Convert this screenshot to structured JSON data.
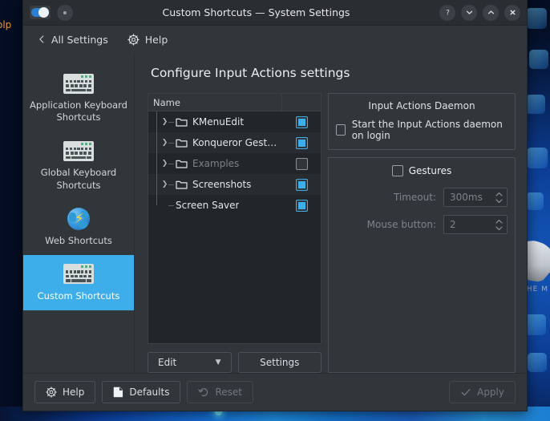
{
  "desktop": {
    "background_window_title": "olp",
    "kde_watermark": "HE  M",
    "accent_color": "#3daee9"
  },
  "window": {
    "title": "Custom Shortcuts — System Settings",
    "titlebar_left": {
      "toggle_name": "window-toggle-switch",
      "menu_button_name": "window-menu-button"
    },
    "controls": [
      {
        "name": "help-button",
        "glyph": "?"
      },
      {
        "name": "minimize-button",
        "glyph": "chevron-down"
      },
      {
        "name": "maximize-button",
        "glyph": "chevron-up"
      },
      {
        "name": "close-button",
        "glyph": "x"
      }
    ]
  },
  "toolbar": {
    "back_label": "All Settings",
    "help_label": "Help"
  },
  "sidebar": {
    "items": [
      {
        "label": "Application Keyboard Shortcuts",
        "icon": "keyboard-icon",
        "selected": false
      },
      {
        "label": "Global Keyboard Shortcuts",
        "icon": "keyboard-icon",
        "selected": false
      },
      {
        "label": "Web Shortcuts",
        "icon": "globe-icon",
        "selected": false
      },
      {
        "label": "Custom Shortcuts",
        "icon": "keyboard-icon",
        "selected": true
      }
    ]
  },
  "main": {
    "page_title": "Configure Input Actions settings",
    "tree": {
      "columns": [
        "Name",
        ""
      ],
      "rows": [
        {
          "label": "KMenuEdit",
          "expandable": true,
          "checked": true,
          "enabled": true
        },
        {
          "label": "Konqueror Gestures",
          "expandable": true,
          "checked": true,
          "enabled": true
        },
        {
          "label": "Examples",
          "expandable": true,
          "checked": false,
          "enabled": false
        },
        {
          "label": "Screenshots",
          "expandable": true,
          "checked": true,
          "enabled": true
        },
        {
          "label": "Screen Saver",
          "expandable": false,
          "checked": true,
          "enabled": true
        }
      ]
    },
    "tree_buttons": {
      "edit_label": "Edit",
      "settings_label": "Settings"
    },
    "daemon_group": {
      "title": "Input Actions Daemon",
      "checkbox_label": "Start the Input Actions daemon on login",
      "checked": false
    },
    "gestures_group": {
      "title": "Gestures",
      "checked": false,
      "fields": [
        {
          "label": "Timeout:",
          "value": "300ms",
          "enabled": false
        },
        {
          "label": "Mouse button:",
          "value": "2",
          "enabled": false
        }
      ]
    }
  },
  "footer": {
    "help_label": "Help",
    "defaults_label": "Defaults",
    "reset_label": "Reset",
    "apply_label": "Apply",
    "reset_enabled": false,
    "apply_enabled": false
  }
}
